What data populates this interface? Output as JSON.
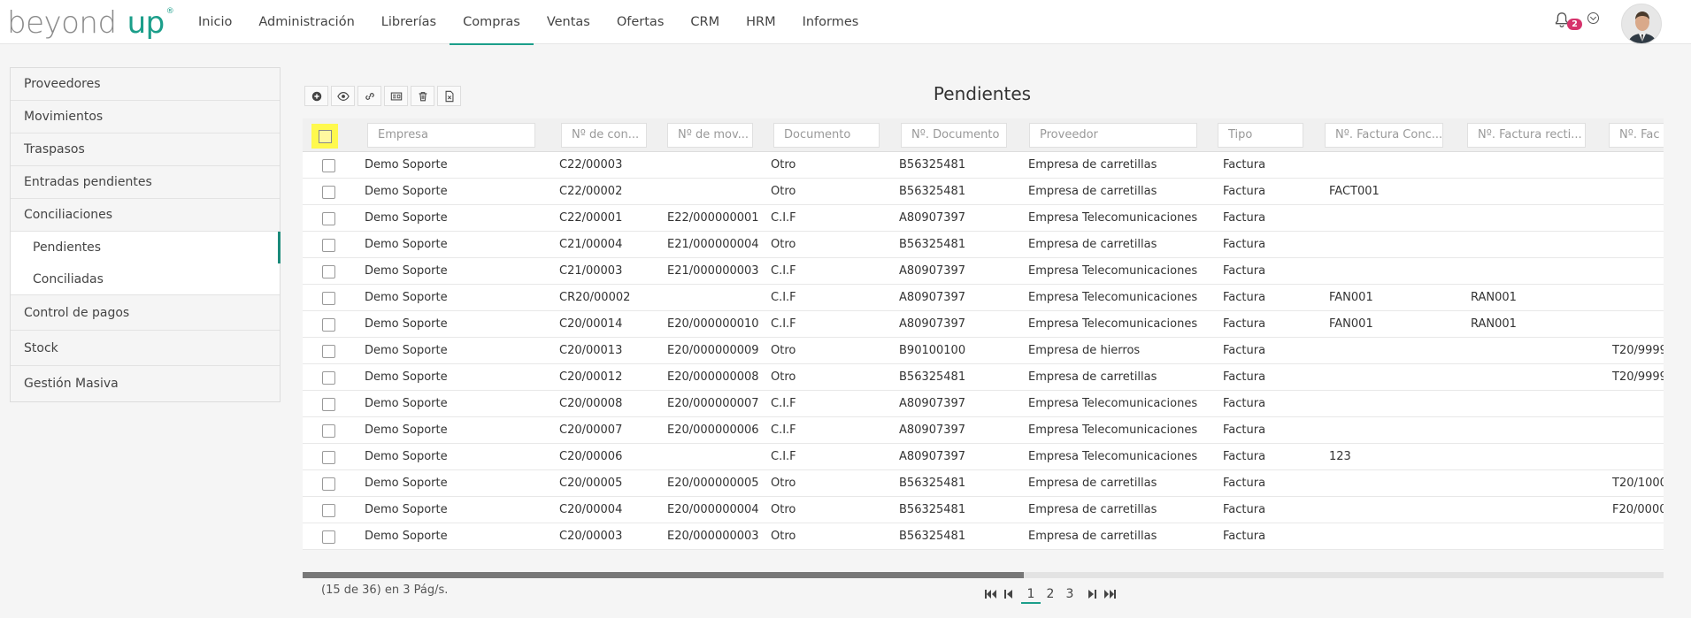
{
  "brand": {
    "word1": "beyond",
    "word2": "up",
    "reg": "®"
  },
  "nav": {
    "items": [
      "Inicio",
      "Administración",
      "Librerías",
      "Compras",
      "Ventas",
      "Ofertas",
      "CRM",
      "HRM",
      "Informes"
    ],
    "active": 3
  },
  "notifications": {
    "count": "2"
  },
  "sidebar": {
    "items": [
      "Proveedores",
      "Movimientos",
      "Traspasos",
      "Entradas pendientes"
    ],
    "group_label": "Conciliaciones",
    "group_items": [
      "Pendientes",
      "Conciliadas"
    ],
    "items_after": [
      "Control de pagos",
      "Stock",
      "Gestión Masiva"
    ]
  },
  "page": {
    "title": "Pendientes"
  },
  "toolbar": {
    "icons": [
      "add-icon",
      "view-icon",
      "link-icon",
      "card-icon",
      "delete-icon",
      "excel-icon"
    ]
  },
  "table": {
    "filters": [
      "Empresa",
      "Nº de con...",
      "Nº de mov...",
      "Documento",
      "Nº. Documento",
      "Proveedor",
      "Tipo",
      "Nº. Factura Conc...",
      "Nº. Factura recti...",
      "Nº. Fac"
    ],
    "rows": [
      [
        "Demo Soporte",
        "C22/00003",
        "",
        "Otro",
        "B56325481",
        "Empresa de carretillas",
        "Factura",
        "",
        "",
        ""
      ],
      [
        "Demo Soporte",
        "C22/00002",
        "",
        "Otro",
        "B56325481",
        "Empresa de carretillas",
        "Factura",
        "FACT001",
        "",
        ""
      ],
      [
        "Demo Soporte",
        "C22/00001",
        "E22/000000001",
        "C.I.F",
        "A80907397",
        "Empresa Telecomunicaciones",
        "Factura",
        "",
        "",
        ""
      ],
      [
        "Demo Soporte",
        "C21/00004",
        "E21/000000004",
        "Otro",
        "B56325481",
        "Empresa de carretillas",
        "Factura",
        "",
        "",
        ""
      ],
      [
        "Demo Soporte",
        "C21/00003",
        "E21/000000003",
        "C.I.F",
        "A80907397",
        "Empresa Telecomunicaciones",
        "Factura",
        "",
        "",
        ""
      ],
      [
        "Demo Soporte",
        "CR20/00002",
        "",
        "C.I.F",
        "A80907397",
        "Empresa Telecomunicaciones",
        "Factura",
        "FAN001",
        "RAN001",
        ""
      ],
      [
        "Demo Soporte",
        "C20/00014",
        "E20/000000010",
        "C.I.F",
        "A80907397",
        "Empresa Telecomunicaciones",
        "Factura",
        "FAN001",
        "RAN001",
        ""
      ],
      [
        "Demo Soporte",
        "C20/00013",
        "E20/000000009",
        "Otro",
        "B90100100",
        "Empresa de hierros",
        "Factura",
        "",
        "",
        "T20/9999"
      ],
      [
        "Demo Soporte",
        "C20/00012",
        "E20/000000008",
        "Otro",
        "B56325481",
        "Empresa de carretillas",
        "Factura",
        "",
        "",
        "T20/9999"
      ],
      [
        "Demo Soporte",
        "C20/00008",
        "E20/000000007",
        "C.I.F",
        "A80907397",
        "Empresa Telecomunicaciones",
        "Factura",
        "",
        "",
        ""
      ],
      [
        "Demo Soporte",
        "C20/00007",
        "E20/000000006",
        "C.I.F",
        "A80907397",
        "Empresa Telecomunicaciones",
        "Factura",
        "",
        "",
        ""
      ],
      [
        "Demo Soporte",
        "C20/00006",
        "",
        "C.I.F",
        "A80907397",
        "Empresa Telecomunicaciones",
        "Factura",
        "123",
        "",
        ""
      ],
      [
        "Demo Soporte",
        "C20/00005",
        "E20/000000005",
        "Otro",
        "B56325481",
        "Empresa de carretillas",
        "Factura",
        "",
        "",
        "T20/1000"
      ],
      [
        "Demo Soporte",
        "C20/00004",
        "E20/000000004",
        "Otro",
        "B56325481",
        "Empresa de carretillas",
        "Factura",
        "",
        "",
        "F20/0000"
      ],
      [
        "Demo Soporte",
        "C20/00003",
        "E20/000000003",
        "Otro",
        "B56325481",
        "Empresa de carretillas",
        "Factura",
        "",
        "",
        ""
      ]
    ]
  },
  "pagination": {
    "summary": "(15 de 36) en 3 Pág/s.",
    "pages": [
      "1",
      "2",
      "3"
    ],
    "active": "1"
  },
  "scrollbar": {
    "position_fraction": 0.53
  },
  "colors": {
    "accent": "#1b9e8a",
    "badge": "#d6336c",
    "highlight": "#fff94d"
  }
}
